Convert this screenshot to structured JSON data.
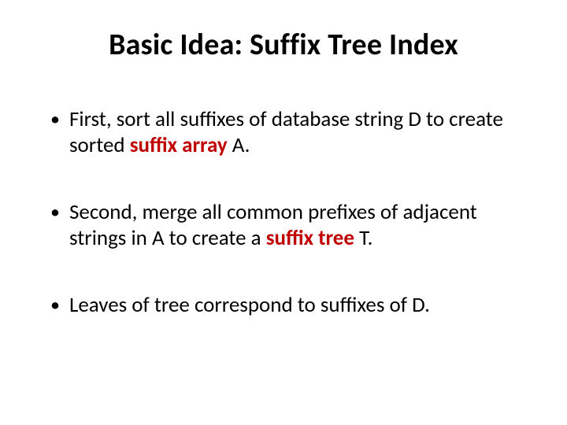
{
  "title": "Basic Idea: Suffix Tree Index",
  "bullets": [
    {
      "t1": "First, sort all suffixes of database string D to create sorted ",
      "strong1": "suffix array",
      "t2": " A."
    },
    {
      "t1": "Second, merge all common prefixes of adjacent strings in A to create a ",
      "strong1": "suffix tree",
      "t2": " T."
    },
    {
      "t1": "Leaves of tree correspond to suffixes of D.",
      "strong1": "",
      "t2": ""
    }
  ]
}
